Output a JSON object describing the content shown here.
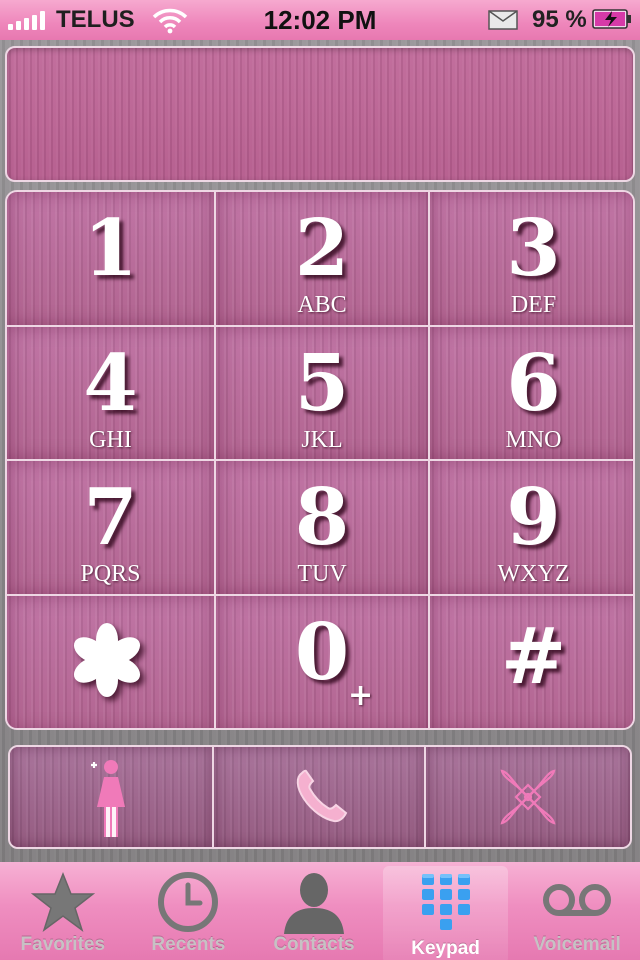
{
  "status_bar": {
    "carrier": "TELUS",
    "time": "12:02 PM",
    "battery_percent": "95 %"
  },
  "display": {
    "number": ""
  },
  "keypad": [
    {
      "digit": "1",
      "letters": ""
    },
    {
      "digit": "2",
      "letters": "ABC"
    },
    {
      "digit": "3",
      "letters": "DEF"
    },
    {
      "digit": "4",
      "letters": "GHI"
    },
    {
      "digit": "5",
      "letters": "JKL"
    },
    {
      "digit": "6",
      "letters": "MNO"
    },
    {
      "digit": "7",
      "letters": "PQRS"
    },
    {
      "digit": "8",
      "letters": "TUV"
    },
    {
      "digit": "9",
      "letters": "WXYZ"
    },
    {
      "digit": "*",
      "letters": ""
    },
    {
      "digit": "0",
      "letters": "+"
    },
    {
      "digit": "#",
      "letters": ""
    }
  ],
  "actions": {
    "add_contact_icon": "add-contact-person-icon",
    "call_icon": "phone-handset-icon",
    "delete_icon": "flower-ornament-icon"
  },
  "tab_bar": {
    "tabs": [
      {
        "label": "Favorites",
        "icon": "star-icon",
        "active": false
      },
      {
        "label": "Recents",
        "icon": "clock-icon",
        "active": false
      },
      {
        "label": "Contacts",
        "icon": "person-silhouette-icon",
        "active": false
      },
      {
        "label": "Keypad",
        "icon": "keypad-grid-icon",
        "active": true
      },
      {
        "label": "Voicemail",
        "icon": "voicemail-icon",
        "active": false
      }
    ]
  },
  "colors": {
    "accent_pink": "#ee86bb",
    "key_pink": "#b8689a",
    "keypad_active_blue": "#3aa0f0"
  }
}
